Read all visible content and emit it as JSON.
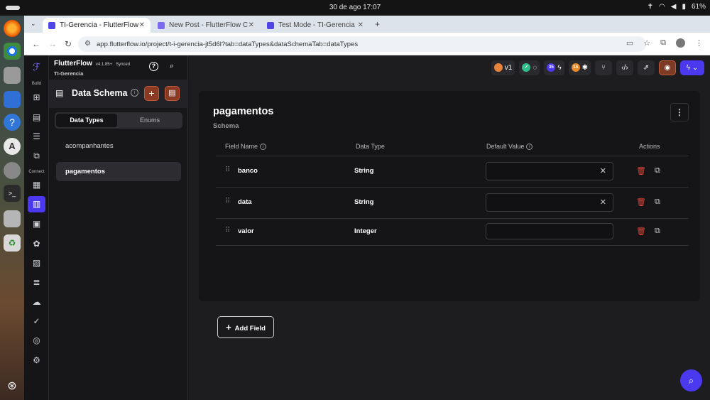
{
  "os": {
    "clock": "30 de ago  17:07",
    "battery": "61%"
  },
  "browser": {
    "tabs": [
      {
        "label": "TI-Gerencia - FlutterFlow"
      },
      {
        "label": "New Post - FlutterFlow C"
      },
      {
        "label": "Test Mode - TI-Gerencia"
      }
    ],
    "url": "app.flutterflow.io/project/t-i-gerencia-jt5d6l?tab=dataTypes&dataSchemaTab=dataTypes"
  },
  "app": {
    "brand": "FlutterFlow",
    "version": "v4.1.85+",
    "sync": "Synced",
    "project": "TI-Gerencia",
    "rail_sections": {
      "build": "Build",
      "connect": "Connect"
    },
    "toolbar": {
      "version_badge": "v1",
      "count_a": "35",
      "count_b": "15"
    }
  },
  "schema": {
    "title": "Data Schema",
    "tabs": [
      "Data Types",
      "Enums"
    ],
    "items": [
      "acompanhantes",
      "pagamentos"
    ]
  },
  "card": {
    "title": "pagamentos",
    "subtitle": "Schema",
    "headers": {
      "field_name": "Field Name",
      "data_type": "Data Type",
      "default_value": "Default Value",
      "actions": "Actions"
    },
    "rows": [
      {
        "name": "banco",
        "type": "String"
      },
      {
        "name": "data",
        "type": "String"
      },
      {
        "name": "valor",
        "type": "Integer"
      }
    ],
    "add_field": "Add Field"
  }
}
